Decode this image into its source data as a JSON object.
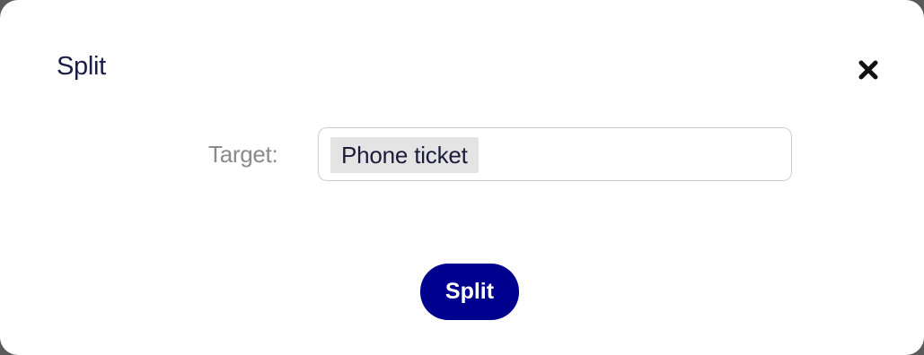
{
  "dialog": {
    "title": "Split",
    "close_icon": "close-icon"
  },
  "form": {
    "target_label": "Target:",
    "target_value": "Phone ticket"
  },
  "actions": {
    "submit_label": "Split",
    "submit_color": "#00008f"
  },
  "colors": {
    "title_text": "#1c1c4a",
    "label_text": "#8a8a8a",
    "token_background": "#e4e4e4"
  }
}
